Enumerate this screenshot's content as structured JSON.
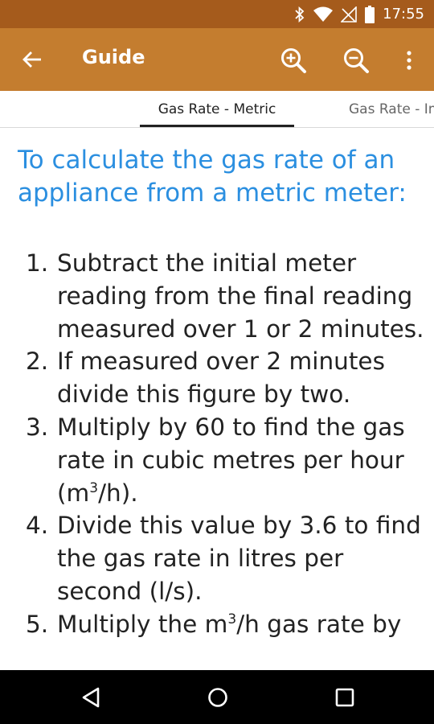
{
  "status_bar": {
    "time": "17:55",
    "icons": [
      "bluetooth-icon",
      "wifi-icon",
      "signal-icon",
      "battery-icon"
    ]
  },
  "app_bar": {
    "title": "Guide",
    "back_icon": "arrow-left-icon",
    "actions": [
      "zoom-in-icon",
      "zoom-out-icon",
      "more-vert-icon"
    ]
  },
  "tabs": [
    {
      "label": "Gas Rate - Metric",
      "selected": true
    },
    {
      "label": "Gas Rate - Imperial",
      "selected": false
    }
  ],
  "content": {
    "heading": "To calculate the gas rate of an appliance from a metric meter:",
    "steps": [
      {
        "number": "1.",
        "text": "Subtract the initial meter reading from the final reading measured over 1 or 2 minutes."
      },
      {
        "number": "2.",
        "text": "If measured over 2 minutes divide this figure by two."
      },
      {
        "number": "3.",
        "text_before": "Multiply by 60 to find the gas rate in cubic metres per hour (m",
        "sup": "3",
        "text_after": "/h)."
      },
      {
        "number": "4.",
        "text": "Divide this value by 3.6 to find the gas rate in litres per second (l/s)."
      },
      {
        "number": "5.",
        "text_before": "Multiply the m",
        "sup": "3",
        "text_after": "/h gas rate by"
      }
    ]
  },
  "nav_bar": {
    "buttons": [
      "nav-back-icon",
      "nav-home-icon",
      "nav-recent-icon"
    ]
  },
  "colors": {
    "status_bar": "#a55b1c",
    "app_bar": "#c47d2f",
    "heading": "#2b8fe0",
    "nav_bar": "#000000"
  }
}
